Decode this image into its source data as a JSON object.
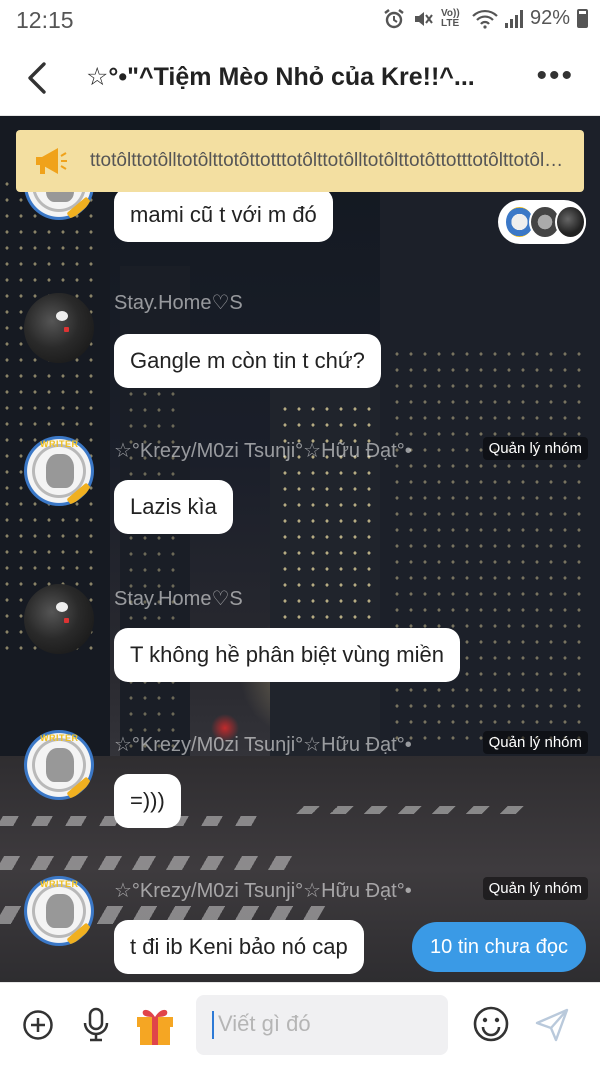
{
  "status_bar": {
    "time": "12:15",
    "volte": "Vo)) LTE",
    "battery": "92%"
  },
  "header": {
    "title": "☆°•\"^Tiệm Mèo Nhỏ của Kre!!^...",
    "more_label": "•••"
  },
  "pinned": {
    "text": "ttotôlttotôlltotôlttotôttotttotôlttotôlltotôlttotôttotttotôlttotôlttotôttotttotô..."
  },
  "messages": [
    {
      "sender": "",
      "role": "",
      "avatar": "writer-avatar",
      "text": "mami cũ t với m đó"
    },
    {
      "sender": "Stay.Home♡S",
      "role": "",
      "avatar": "dark-avatar",
      "text": "Gangle m còn tin t chứ?"
    },
    {
      "sender": "☆°Krezy/M0zi Tsunji°☆Hữu Đạt°•",
      "role": "Quản lý nhóm",
      "avatar": "writer-avatar",
      "text": "Lazis kìa"
    },
    {
      "sender": "Stay.Home♡S",
      "role": "",
      "avatar": "dark-avatar",
      "text": "T không hề phân biệt vùng miền"
    },
    {
      "sender": "☆°Krezy/M0zi Tsunji°☆Hữu Đạt°•",
      "role": "Quản lý nhóm",
      "avatar": "writer-avatar",
      "text": "=)))"
    },
    {
      "sender": "☆°Krezy/M0zi Tsunji°☆Hữu Đạt°•",
      "role": "Quản lý nhóm",
      "avatar": "writer-avatar",
      "text": "t đi ib Keni bảo nó cap"
    }
  ],
  "unread_button": {
    "label": "10 tin chưa đọc"
  },
  "composer": {
    "placeholder": "Viết gì đó",
    "icons": [
      "plus-icon",
      "microphone-icon",
      "gift-icon",
      "emoji-icon",
      "send-icon"
    ]
  },
  "colors": {
    "accent": "#3a9ae6",
    "pinned_bg": "#f3dfa1",
    "megaphone": "#f0a21a"
  }
}
